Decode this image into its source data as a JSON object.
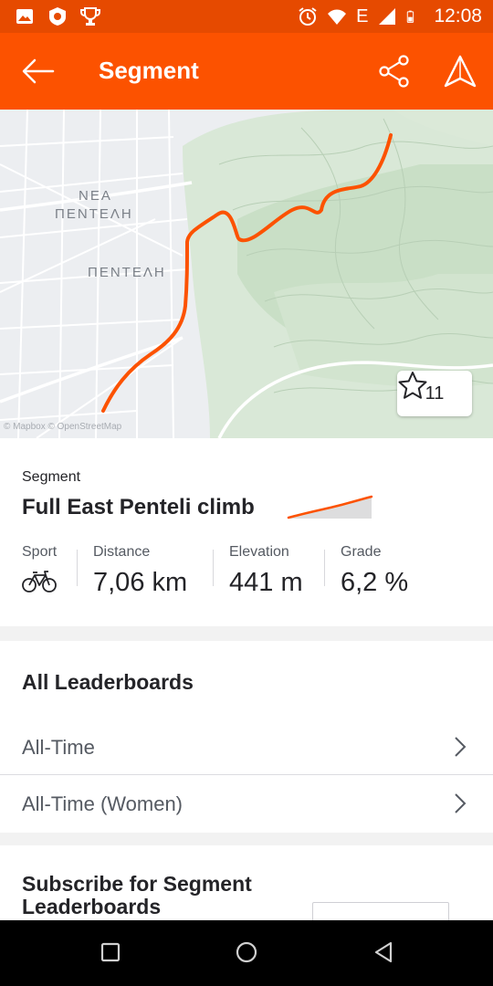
{
  "status_bar": {
    "time": "12:08",
    "network": "E",
    "icons": [
      "gallery-icon",
      "badge-icon",
      "trophy-icon",
      "alarm-icon",
      "wifi-icon",
      "signal-icon",
      "battery-icon"
    ]
  },
  "app_bar": {
    "title": "Segment",
    "back_icon": "arrow-left-icon",
    "share_icon": "share-icon",
    "navigate_icon": "navigate-icon"
  },
  "map": {
    "labels": [
      "ΝΕΑ",
      "ΠΕΝΤΕΛΗ",
      "ΠΕΝΤΕΛΗ"
    ],
    "attribution": "© Mapbox © OpenStreetMap",
    "star_count": "11",
    "route_color": "#fc5200"
  },
  "segment": {
    "kicker": "Segment",
    "name": "Full East Penteli climb",
    "stats": [
      {
        "label": "Sport",
        "icon": "bike-icon"
      },
      {
        "label": "Distance",
        "value": "7,06 km"
      },
      {
        "label": "Elevation",
        "value": "441 m"
      },
      {
        "label": "Grade",
        "value": "6,2 %"
      }
    ]
  },
  "leaderboards": {
    "title": "All Leaderboards",
    "rows": [
      {
        "label": "All-Time"
      },
      {
        "label": "All-Time (Women)"
      }
    ]
  },
  "subscribe": {
    "title": "Subscribe for Segment Leaderboards"
  },
  "colors": {
    "brand": "#fc5200",
    "status_bar": "#e64a00"
  }
}
